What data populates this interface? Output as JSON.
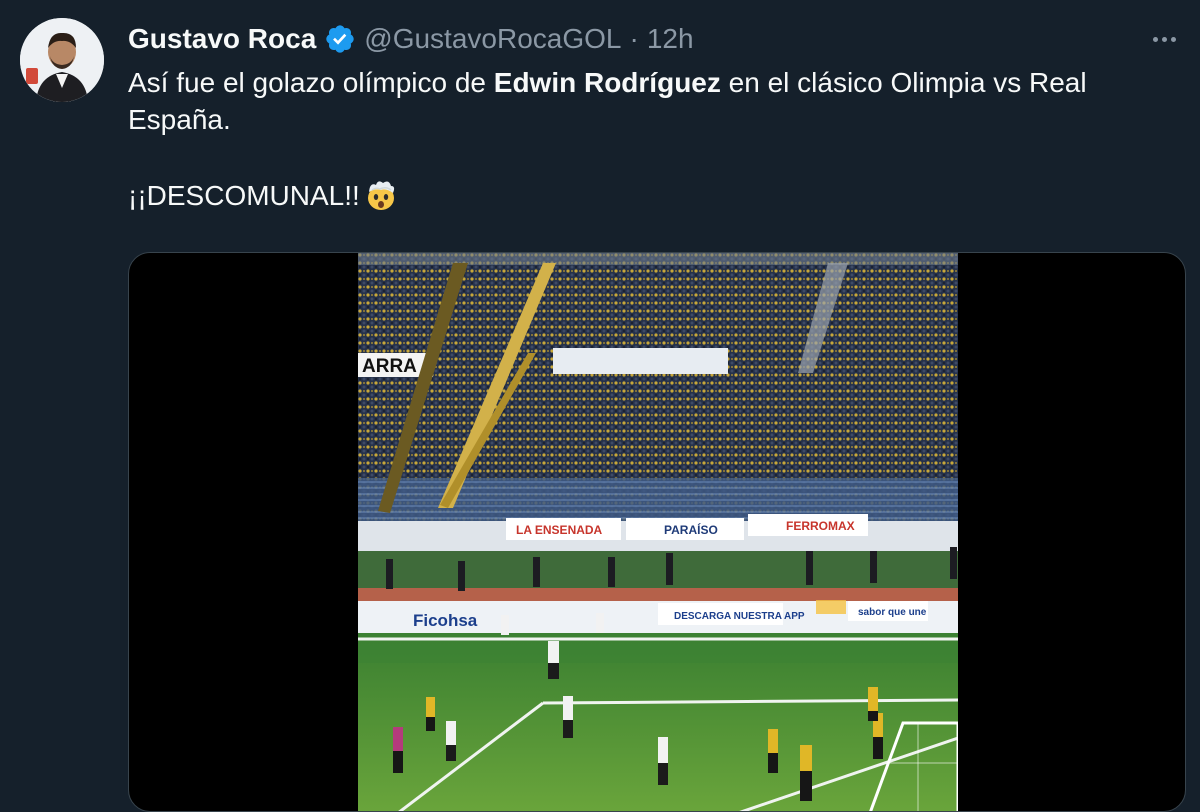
{
  "author": {
    "name": "Gustavo Roca",
    "handle": "@GustavoRocaGOL",
    "separator": "·",
    "time": "12h",
    "verified": true,
    "verified_color": "#1d9bf0"
  },
  "icons": {
    "verified": "verified-badge-icon",
    "more": "more-options-icon",
    "emoji": "exploding-head-emoji"
  },
  "tweet": {
    "line1_before": "Así fue el golazo olímpico de ",
    "line1_bold": "Edwin Rodríguez",
    "line1_after": " en el clásico Olimpia vs Real España.",
    "line2": "¡¡DESCOMUNAL!!"
  },
  "video": {
    "banner_left": "ARRA",
    "ads": [
      {
        "label": "LA ENSENADA"
      },
      {
        "label": "PARAÍSO"
      },
      {
        "label": "FERROMAX"
      }
    ],
    "lower_ads": [
      {
        "label": "Ficohsa"
      },
      {
        "label": "DESCARGA NUESTRA APP"
      },
      {
        "label": "sabor que une"
      }
    ]
  }
}
